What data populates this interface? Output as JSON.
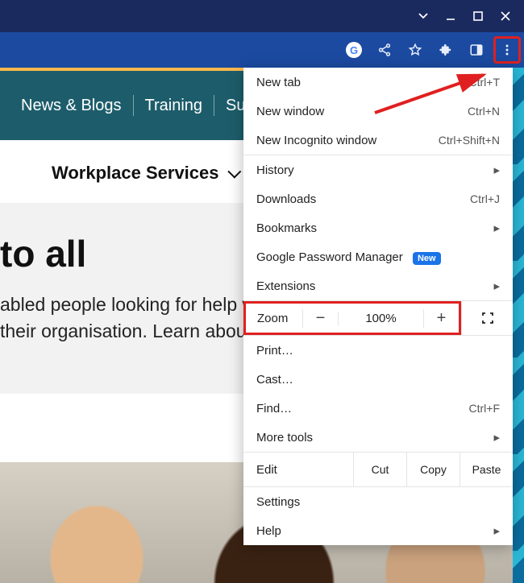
{
  "window": {
    "titlebar_icons": [
      "dropdown",
      "minimize",
      "maximize",
      "close"
    ]
  },
  "toolbar": {
    "icons": [
      "google",
      "share",
      "star",
      "extensions",
      "side-panel",
      "more"
    ]
  },
  "page": {
    "nav": {
      "items": [
        "News & Blogs",
        "Training",
        "Supp"
      ]
    },
    "subheader": "Workplace Services",
    "headline": "to all",
    "body_line1": "abled people looking for help with t",
    "body_line2": " their organisation. Learn about ou"
  },
  "menu": {
    "new_tab": {
      "label": "New tab",
      "shortcut": "Ctrl+T"
    },
    "new_window": {
      "label": "New window",
      "shortcut": "Ctrl+N"
    },
    "new_incognito": {
      "label": "New Incognito window",
      "shortcut": "Ctrl+Shift+N"
    },
    "history": {
      "label": "History"
    },
    "downloads": {
      "label": "Downloads",
      "shortcut": "Ctrl+J"
    },
    "bookmarks": {
      "label": "Bookmarks"
    },
    "password_manager": {
      "label": "Google Password Manager",
      "badge": "New"
    },
    "extensions": {
      "label": "Extensions"
    },
    "zoom": {
      "label": "Zoom",
      "minus": "−",
      "value": "100%",
      "plus": "+"
    },
    "print": {
      "label": "Print…"
    },
    "cast": {
      "label": "Cast…"
    },
    "find": {
      "label": "Find…",
      "shortcut": "Ctrl+F"
    },
    "more_tools": {
      "label": "More tools"
    },
    "edit": {
      "label": "Edit",
      "cut": "Cut",
      "copy": "Copy",
      "paste": "Paste"
    },
    "settings": {
      "label": "Settings"
    },
    "help": {
      "label": "Help"
    }
  }
}
